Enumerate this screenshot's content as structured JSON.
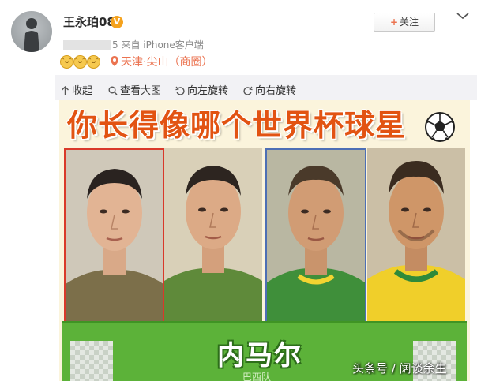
{
  "post": {
    "username": "王永珀08",
    "verified_badge": "V",
    "time_blurred": "5",
    "source": "来自 iPhone客户端",
    "emoji_icons": [
      "grin-emoji-icon",
      "grin-emoji-icon",
      "grin-emoji-icon"
    ],
    "location": "天津·尖山（商圈）",
    "follow_label": "关注",
    "follow_plus": "+"
  },
  "toolbar": {
    "items": [
      {
        "label": "收起",
        "icon": "collapse-arrow-icon"
      },
      {
        "label": "查看大图",
        "icon": "magnifier-icon"
      },
      {
        "label": "向左旋转",
        "icon": "rotate-left-icon"
      },
      {
        "label": "向右旋转",
        "icon": "rotate-right-icon"
      }
    ]
  },
  "image": {
    "headline": "你长得像哪个世界杯球星",
    "player_name": "内马尔",
    "team": "巴西队",
    "watermark": "头条号 / 阔谈余生"
  },
  "colors": {
    "accent": "#eb7350",
    "headline": "#e25312",
    "panel_green": "#5cb239",
    "badge": "#f5a21c"
  }
}
